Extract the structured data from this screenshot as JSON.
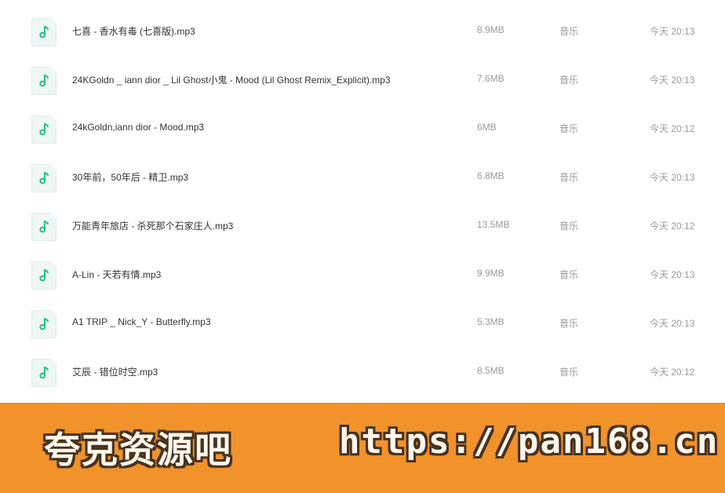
{
  "colors": {
    "icon_accent": "#2dbf8f",
    "name_text": "#333333",
    "meta_text": "#999999",
    "banner_bg": "#f08a1c"
  },
  "files": [
    {
      "name": "七喜 - 香水有毒 (七喜版).mp3",
      "size": "8.9MB",
      "type": "音乐",
      "time": "今天 20:13"
    },
    {
      "name": "24KGoldn _ iann dior _ Lil Ghost小鬼 - Mood (Lil Ghost Remix_Explicit).mp3",
      "size": "7.6MB",
      "type": "音乐",
      "time": "今天 20:13"
    },
    {
      "name": "24kGoldn,iann dior - Mood.mp3",
      "size": "6MB",
      "type": "音乐",
      "time": "今天 20:12"
    },
    {
      "name": "30年前，50年后 - 精卫.mp3",
      "size": "6.8MB",
      "type": "音乐",
      "time": "今天 20:13"
    },
    {
      "name": "万能青年旅店 - 杀死那个石家庄人.mp3",
      "size": "13.5MB",
      "type": "音乐",
      "time": "今天 20:12"
    },
    {
      "name": "A-Lin - 天若有情.mp3",
      "size": "9.9MB",
      "type": "音乐",
      "time": "今天 20:13"
    },
    {
      "name": "A1 TRIP _ Nick_Y - Butterfly.mp3",
      "size": "5.3MB",
      "type": "音乐",
      "time": "今天 20:13"
    },
    {
      "name": "艾辰 - 错位时空.mp3",
      "size": "8.5MB",
      "type": "音乐",
      "time": "今天 20:12"
    }
  ],
  "watermark": {
    "left_text": "夸克资源吧",
    "right_text": "https://pan168.cn"
  }
}
